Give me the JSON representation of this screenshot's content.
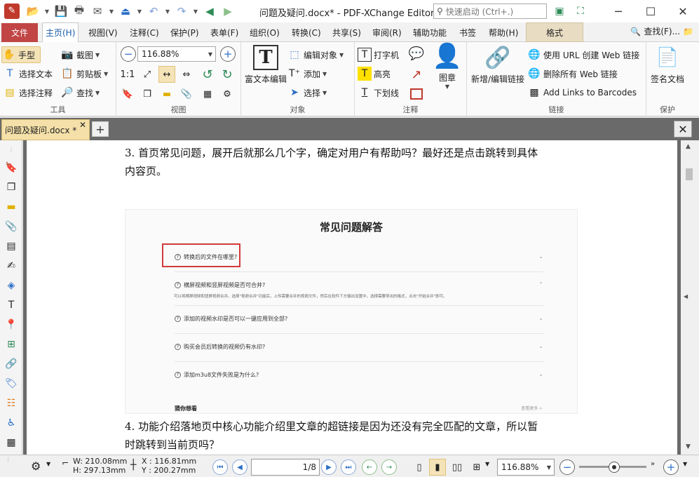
{
  "window": {
    "title": "问题及疑问.docx* - PDF-XChange Editor",
    "quick_launch_placeholder": "快速启动 (Ctrl+.)"
  },
  "menu": {
    "file": "文件",
    "tabs": [
      "主页(H)",
      "视图(V)",
      "注释(C)",
      "保护(P)",
      "表单(F)",
      "组织(O)",
      "转换(C)",
      "共享(S)",
      "审阅(R)",
      "辅助功能",
      "书签",
      "帮助(H)"
    ],
    "format": "格式",
    "find": "查找(F)..."
  },
  "ribbon": {
    "tools": {
      "hand": "手型",
      "snapshot": "截图",
      "select_text": "选择文本",
      "clipboard": "剪贴板",
      "select_comment": "选择注释",
      "find": "查找",
      "label": "工具"
    },
    "view": {
      "zoom": "116.88%",
      "label": "视图"
    },
    "objects": {
      "rich_text": "富文本编辑",
      "edit_object": "编辑对象",
      "add": "添加",
      "select": "选择",
      "label": "对象"
    },
    "comments": {
      "typewriter": "打字机",
      "highlight": "高亮",
      "underline": "下划线",
      "label": "注释"
    },
    "stamp": {
      "label": "图章"
    },
    "links": {
      "add_edit": "新增/编辑链接",
      "create_web": "使用 URL 创建 Web 链接",
      "delete_web": "删除所有 Web 链接",
      "barcodes": "Add Links to Barcodes",
      "label": "链接"
    },
    "protect": {
      "sign": "签名文档",
      "label": "保护"
    }
  },
  "tab": {
    "name": "问题及疑问.docx *"
  },
  "document": {
    "para3_line1": "3. 首页常见问题，展开后就那么几个字，确定对用户有帮助吗？最好还是点击跳转到具体",
    "para3_line2": "内容页。",
    "para4_line1": "4. 功能介绍落地页中核心功能介绍里文章的超链接是因为还没有完全匹配的文章，所以暂",
    "para4_line2": "时跳转到当前页吗？",
    "faq_title": "常见问题解答",
    "faq_items": [
      "转换后的文件在哪里?",
      "横屏视频和竖屏视频是否可合并?",
      "添加的视频水印是否可以一键应用到全部?",
      "购买会员后转换的视频仍有水印?",
      "添加m3u8文件失败是为什么?"
    ],
    "faq_answer": "可以将横屏视频和竖屏视频合并。选择\"视频合并\"功能后，上传需要合并的视频文件，然后在软件下方输出设置中，选择需要导出的格式，点击\"开始合并\"即可。",
    "guess_title": "猜你想看",
    "see_more": "查看更多 »"
  },
  "status": {
    "width": "W: 210.08mm",
    "height": "H: 297.13mm",
    "x": "X : 116.81mm",
    "y": "Y : 200.27mm",
    "page": "1",
    "page_total": "/8",
    "zoom": "116.88%"
  }
}
